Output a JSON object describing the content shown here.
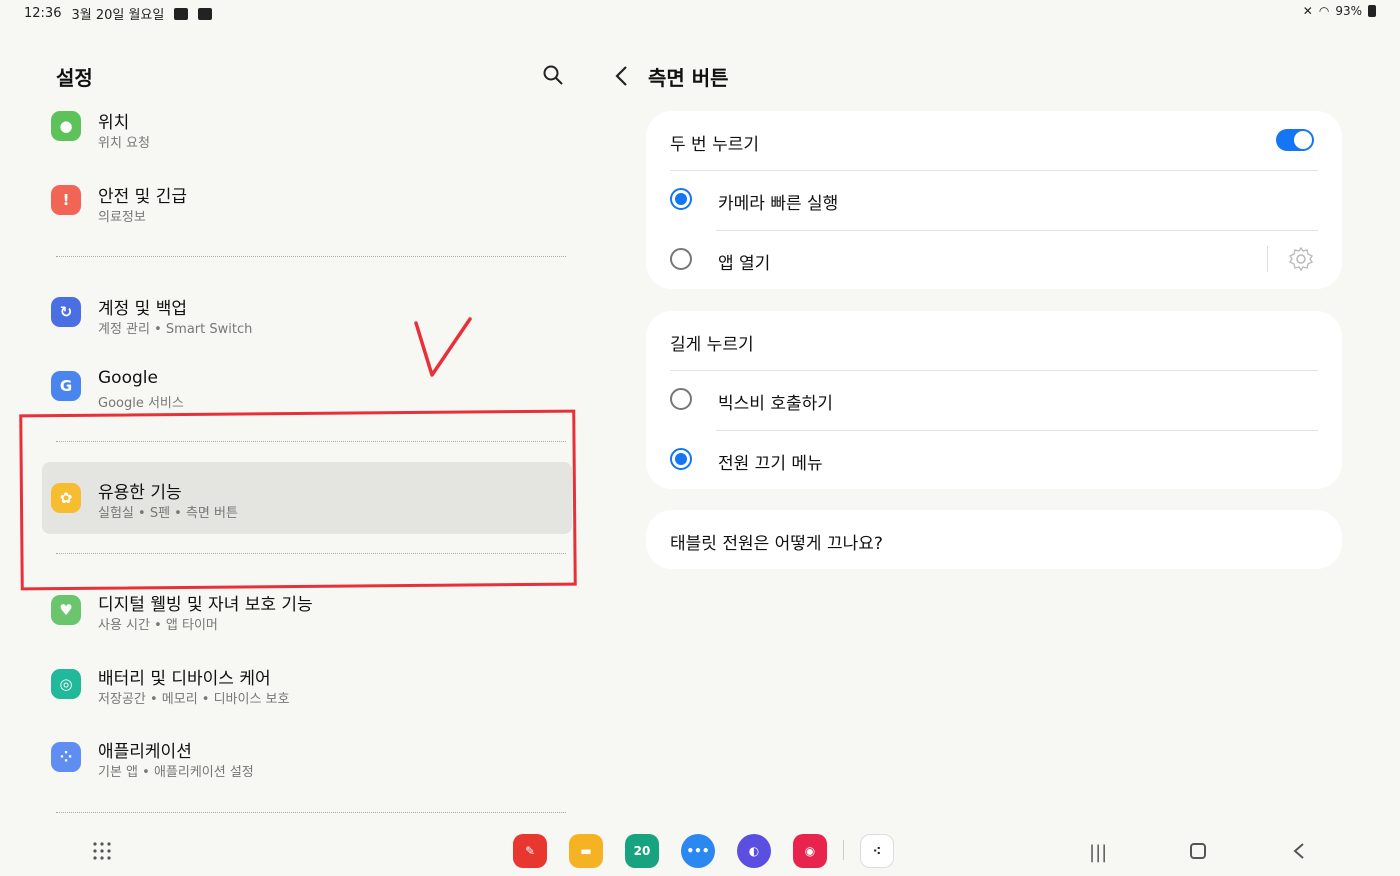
{
  "status_bar": {
    "time": "12:36",
    "date": "3월 20일 월요일",
    "battery": "93%"
  },
  "left": {
    "title": "설정",
    "items": [
      {
        "title": "위치",
        "sub": "위치 요청",
        "icon": "location-pin-icon",
        "color": "#5ec25a"
      },
      {
        "title": "안전 및 긴급",
        "sub": "의료정보",
        "icon": "emergency-icon",
        "color": "#f06554"
      },
      {
        "title": "계정 및 백업",
        "sub": "계정 관리 • Smart Switch",
        "icon": "sync-icon",
        "color": "#4a6fe3"
      },
      {
        "title": "Google",
        "sub": "Google 서비스",
        "icon": "google-icon",
        "color": "#4a85ef"
      },
      {
        "title": "유용한 기능",
        "sub": "실험실 • S펜 • 측면 버튼",
        "icon": "puzzle-icon",
        "color": "#f6bd31"
      },
      {
        "title": "디지털 웰빙 및 자녀 보호 기능",
        "sub": "사용 시간 • 앱 타이머",
        "icon": "wellbeing-icon",
        "color": "#6ac56c"
      },
      {
        "title": "배터리 및 디바이스 케어",
        "sub": "저장공간 • 메모리 • 디바이스 보호",
        "icon": "device-care-icon",
        "color": "#22b89a"
      },
      {
        "title": "애플리케이션",
        "sub": "기본 앱 • 애플리케이션 설정",
        "icon": "apps-grid-icon",
        "color": "#5f8ef3"
      }
    ]
  },
  "right": {
    "title": "측면 버튼",
    "double_press": {
      "label": "두 번 누르기",
      "enabled": true,
      "options": [
        {
          "label": "카메라 빠른 실행",
          "selected": true
        },
        {
          "label": "앱 열기",
          "selected": false
        }
      ]
    },
    "long_press": {
      "label": "길게 누르기",
      "options": [
        {
          "label": "빅스비 호출하기",
          "selected": false
        },
        {
          "label": "전원 끄기 메뉴",
          "selected": true
        }
      ]
    },
    "help_link": "태블릿 전원은 어떻게 끄나요?"
  },
  "dock": {
    "calendar_day": "20"
  },
  "colors": {
    "accent": "#1476f5",
    "annotation": "#e8303a"
  }
}
